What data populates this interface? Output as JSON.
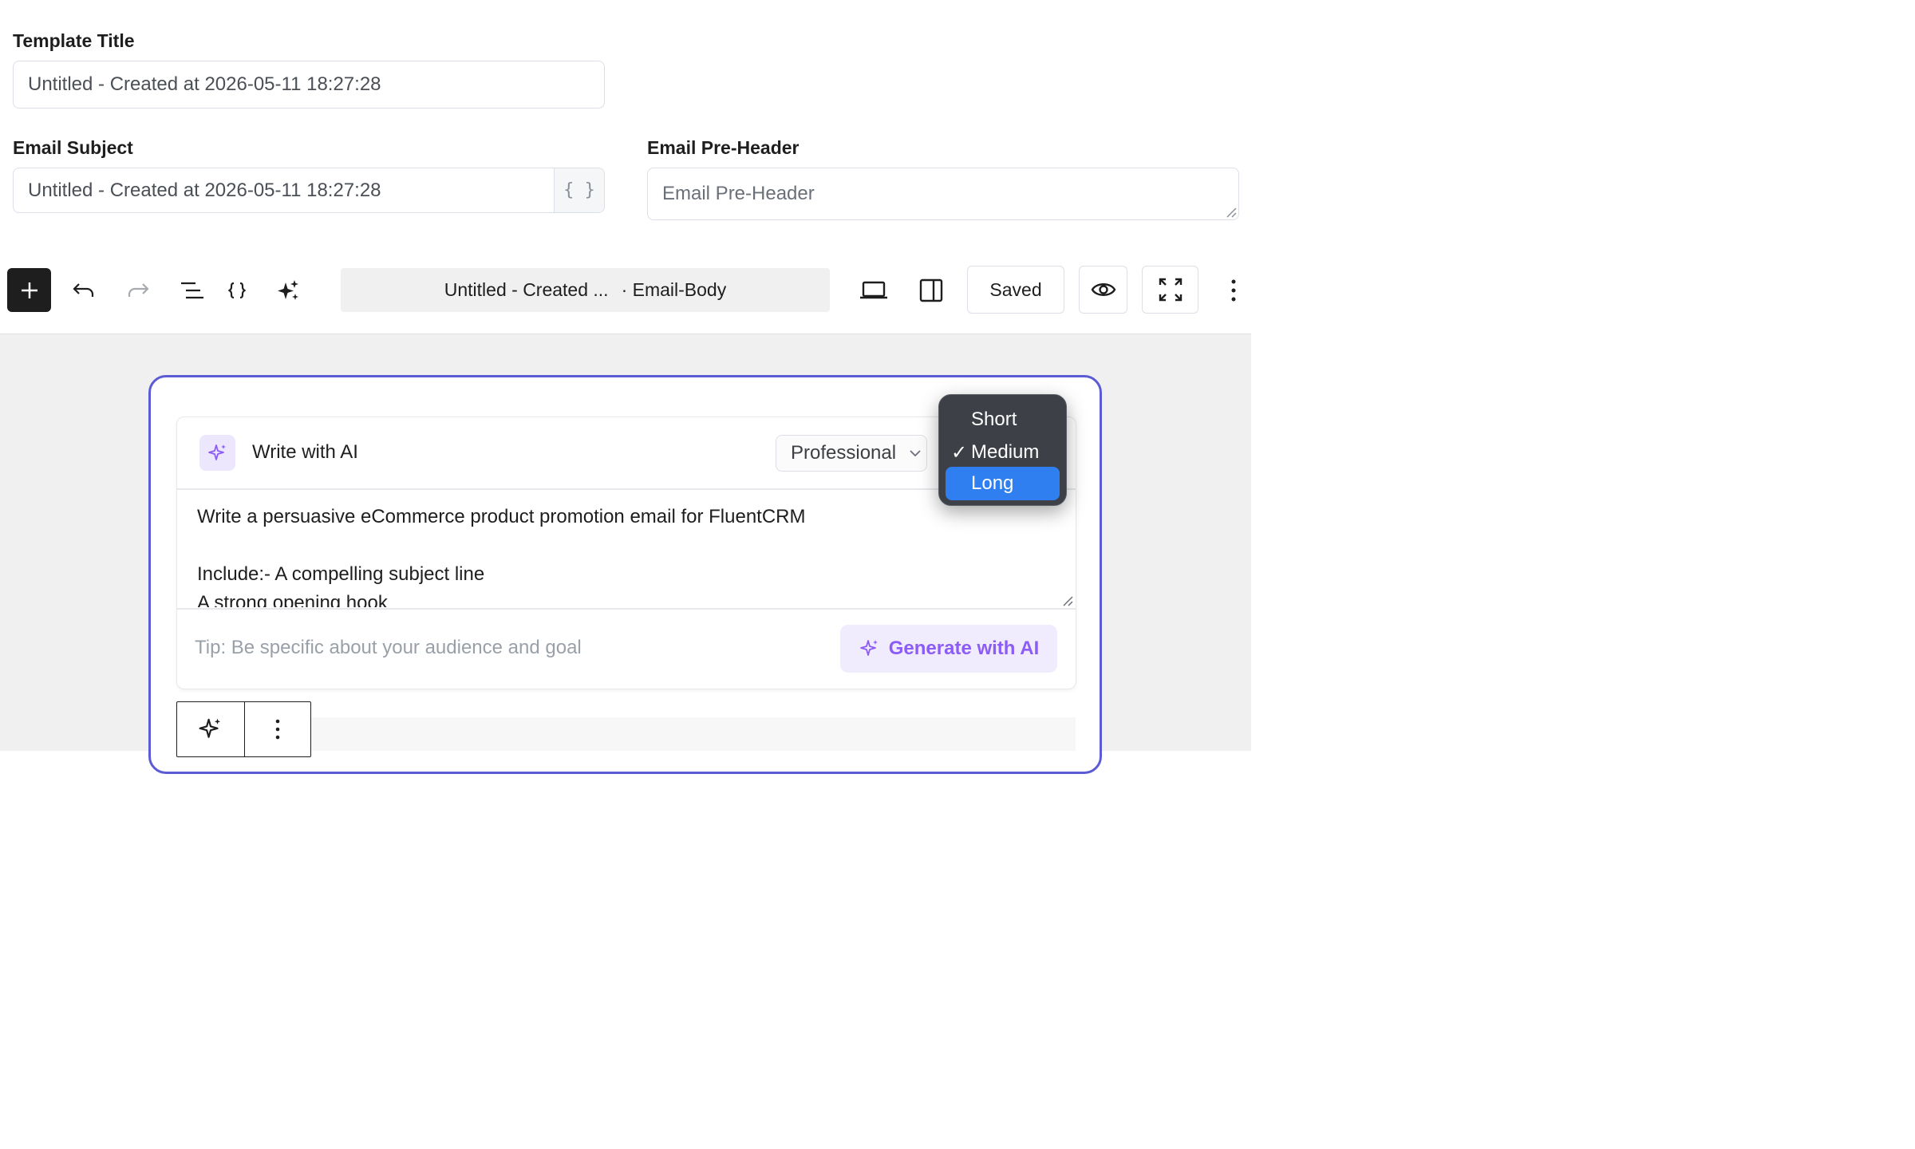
{
  "template_title": {
    "label": "Template Title",
    "value": "Untitled - Created at 2026-05-11 18:27:28"
  },
  "email_subject": {
    "label": "Email Subject",
    "value": "Untitled - Created at 2026-05-11 18:27:28",
    "addon": "{ }"
  },
  "pre_header": {
    "label": "Email Pre-Header",
    "placeholder": "Email Pre-Header"
  },
  "toolbar": {
    "doc_title": "Untitled - Created ...",
    "doc_suffix": "· Email-Body",
    "saved_label": "Saved",
    "icons": [
      "plus-icon",
      "undo-icon",
      "redo-icon",
      "list-view-icon",
      "code-braces-icon",
      "sparkles-icon",
      "desktop-preview-icon",
      "sidebar-toggle-icon",
      "eye-icon",
      "fullscreen-icon",
      "more-vertical-icon"
    ]
  },
  "ai_panel": {
    "title": "Write with AI",
    "tone_value": "Professional",
    "prompt_lines": [
      "Write a persuasive eCommerce product promotion email for FluentCRM",
      "",
      "Include:- A compelling subject line",
      "A strong opening hook"
    ],
    "tip": "Tip: Be specific about your audience and goal",
    "generate_label": "Generate with AI"
  },
  "length_menu": {
    "options": [
      "Short",
      "Medium",
      "Long"
    ],
    "checked": "Medium",
    "highlighted": "Long",
    "check_mark": "✓"
  },
  "colors": {
    "accent": "#3858e9",
    "ai_purple": "#8b5cf6",
    "selection_border": "#5b5bd6",
    "menu_highlight": "#2f7ff0"
  }
}
